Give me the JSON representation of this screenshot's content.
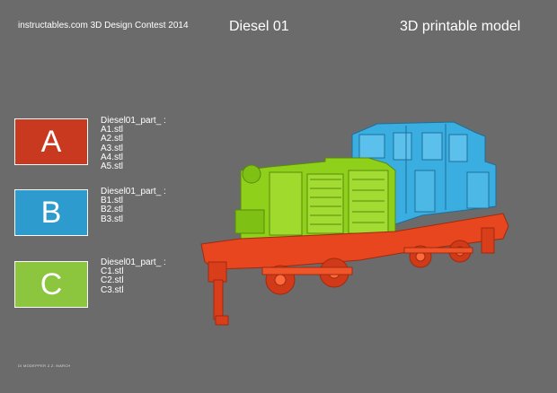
{
  "header": {
    "contest": "instructables.com 3D Design Contest 2014",
    "title": "Diesel 01",
    "subtitle": "3D printable model"
  },
  "parts": [
    {
      "letter": "A",
      "color": "#c8391f",
      "prefix": "Diesel01_part_ :",
      "files": [
        "A1.stl",
        "A2.stl",
        "A3.stl",
        "A4.stl",
        "A5.stl"
      ]
    },
    {
      "letter": "B",
      "color": "#2e9bcf",
      "prefix": "Diesel01_part_ :",
      "files": [
        "B1.stl",
        "B2.stl",
        "B3.stl"
      ]
    },
    {
      "letter": "C",
      "color": "#8cc63f",
      "prefix": "Diesel01_part_ :",
      "files": [
        "C1.stl",
        "C2.stl",
        "C3.stl"
      ]
    }
  ],
  "footer": "DI MODEPPER Z.Z. MARCH",
  "model_colors": {
    "chassis": "#e8461f",
    "hood": "#8ed01a",
    "cab": "#3aaee0"
  }
}
